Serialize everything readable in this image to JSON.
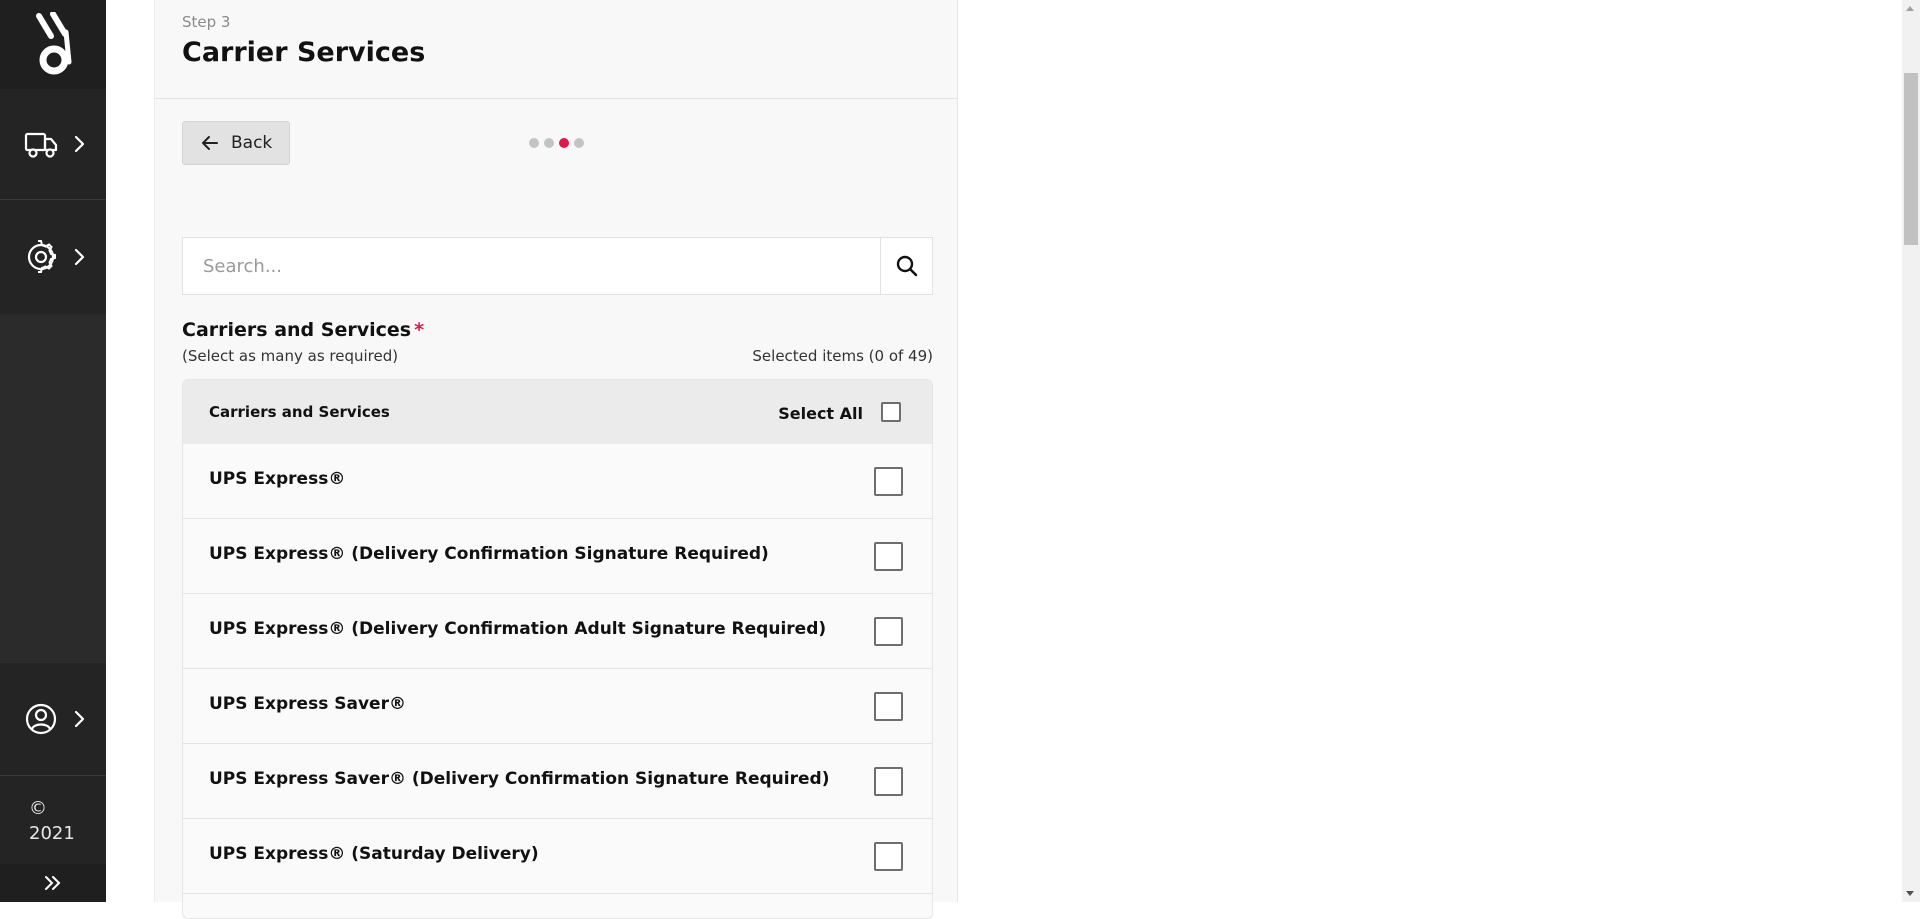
{
  "sidebar": {
    "logo_icon": "brand-logo-icon",
    "nav_items": [
      {
        "icon": "truck-icon",
        "chevron": "chevron-right-icon"
      },
      {
        "icon": "gear-icon",
        "chevron": "chevron-right-icon"
      },
      {
        "icon": "user-circle-icon",
        "chevron": "chevron-right-icon"
      }
    ],
    "copyright_symbol": "©",
    "copyright_year": "2021",
    "expand_icon": "double-chevron-right-icon"
  },
  "header": {
    "step_label": "Step 3",
    "title": "Carrier Services"
  },
  "wizard": {
    "back_label": "Back",
    "steps_total": 4,
    "current_step": 3
  },
  "search": {
    "placeholder": "Search...",
    "value": ""
  },
  "services_section": {
    "title": "Carriers and Services",
    "required_mark": "*",
    "subtitle": "(Select as many as required)",
    "selected_text": "Selected items (0 of 49)"
  },
  "table": {
    "column_header": "Carriers and Services",
    "select_all_label": "Select All",
    "rows": [
      {
        "name": "UPS Express®",
        "checked": false
      },
      {
        "name": "UPS Express® (Delivery Confirmation Signature Required)",
        "checked": false
      },
      {
        "name": "UPS Express® (Delivery Confirmation Adult Signature Required)",
        "checked": false
      },
      {
        "name": "UPS Express Saver®",
        "checked": false
      },
      {
        "name": "UPS Express Saver® (Delivery Confirmation Signature Required)",
        "checked": false
      },
      {
        "name": "UPS Express® (Saturday Delivery)",
        "checked": false
      }
    ]
  },
  "colors": {
    "accent": "#e0174d",
    "sidebar_bg": "#2b2b2b"
  }
}
